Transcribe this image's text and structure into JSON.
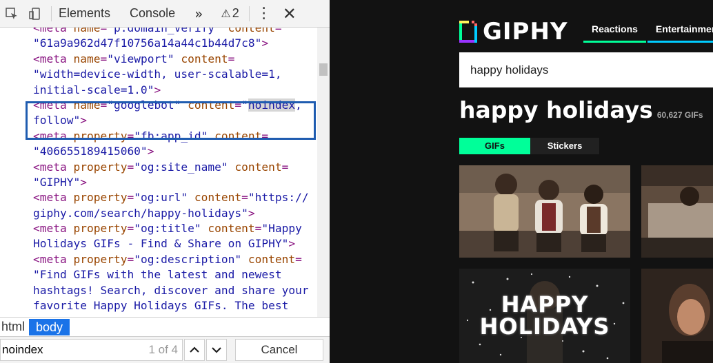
{
  "devtools": {
    "tabs": {
      "elements": "Elements",
      "console": "Console",
      "more": "»"
    },
    "warnings": {
      "icon": "warning-icon",
      "count": "2"
    },
    "code_lines": [
      [
        [
          "tag",
          "<meta "
        ],
        [
          "attr",
          "name"
        ],
        [
          "punct",
          "="
        ],
        [
          "val",
          "\"p:domain_verify\""
        ],
        [
          "attr",
          " content"
        ],
        [
          "punct",
          "="
        ]
      ],
      [
        [
          "val",
          "\"61a9a962d47f10756a14a44c1b44d7c8\""
        ],
        [
          "tag",
          ">"
        ]
      ],
      [
        [
          "tag",
          "<meta "
        ],
        [
          "attr",
          "name"
        ],
        [
          "punct",
          "="
        ],
        [
          "val",
          "\"viewport\""
        ],
        [
          "attr",
          " content"
        ],
        [
          "punct",
          "="
        ]
      ],
      [
        [
          "val",
          "\"width=device-width, user-scalable=1,"
        ]
      ],
      [
        [
          "val",
          "initial-scale=1.0\""
        ],
        [
          "tag",
          ">"
        ]
      ],
      [
        [
          "tag",
          "<meta "
        ],
        [
          "attr",
          "name"
        ],
        [
          "punct",
          "="
        ],
        [
          "val",
          "\"googlebot\""
        ],
        [
          "attr",
          " content"
        ],
        [
          "punct",
          "="
        ],
        [
          "val",
          "\""
        ],
        [
          "hl",
          "noindex"
        ],
        [
          "val",
          ","
        ]
      ],
      [
        [
          "val",
          "follow\""
        ],
        [
          "tag",
          ">"
        ]
      ],
      [
        [
          "tag",
          "<meta "
        ],
        [
          "attr",
          "property"
        ],
        [
          "punct",
          "="
        ],
        [
          "val",
          "\"fb:app_id\""
        ],
        [
          "attr",
          " content"
        ],
        [
          "punct",
          "="
        ]
      ],
      [
        [
          "val",
          "\"406655189415060\""
        ],
        [
          "tag",
          ">"
        ]
      ],
      [
        [
          "tag",
          "<meta "
        ],
        [
          "attr",
          "property"
        ],
        [
          "punct",
          "="
        ],
        [
          "val",
          "\"og:site_name\""
        ],
        [
          "attr",
          " content"
        ],
        [
          "punct",
          "="
        ]
      ],
      [
        [
          "val",
          "\"GIPHY\""
        ],
        [
          "tag",
          ">"
        ]
      ],
      [
        [
          "tag",
          "<meta "
        ],
        [
          "attr",
          "property"
        ],
        [
          "punct",
          "="
        ],
        [
          "val",
          "\"og:url\""
        ],
        [
          "attr",
          " content"
        ],
        [
          "punct",
          "="
        ],
        [
          "val",
          "\"https://"
        ]
      ],
      [
        [
          "val",
          "giphy.com/search/happy-holidays\""
        ],
        [
          "tag",
          ">"
        ]
      ],
      [
        [
          "tag",
          "<meta "
        ],
        [
          "attr",
          "property"
        ],
        [
          "punct",
          "="
        ],
        [
          "val",
          "\"og:title\""
        ],
        [
          "attr",
          " content"
        ],
        [
          "punct",
          "="
        ],
        [
          "val",
          "\"Happy"
        ]
      ],
      [
        [
          "val",
          "Holidays GIFs - Find & Share on GIPHY\""
        ],
        [
          "tag",
          ">"
        ]
      ],
      [
        [
          "tag",
          "<meta "
        ],
        [
          "attr",
          "property"
        ],
        [
          "punct",
          "="
        ],
        [
          "val",
          "\"og:description\""
        ],
        [
          "attr",
          " content"
        ],
        [
          "punct",
          "="
        ]
      ],
      [
        [
          "val",
          "\"Find GIFs with the latest and newest"
        ]
      ],
      [
        [
          "val",
          "hashtags! Search, discover and share your"
        ]
      ],
      [
        [
          "val",
          "favorite Happy Holidays GIFs. The best"
        ]
      ]
    ],
    "breadcrumb": {
      "html": "html",
      "body": "body"
    },
    "find": {
      "query": "noindex",
      "count": "1 of 4",
      "cancel": "Cancel"
    }
  },
  "giphy": {
    "logo_text": "GIPHY",
    "nav": [
      {
        "label": "Reactions",
        "color": "#00ff99"
      },
      {
        "label": "Entertainment",
        "color": "#00ccff"
      }
    ],
    "search_value": "happy holidays",
    "title": "happy holidays",
    "count": "60,627 GIFs",
    "tabs": {
      "gifs": "GIFs",
      "stickers": "Stickers"
    },
    "gif_text": {
      "line1": "HAPPY",
      "line2": "HOLIDAYS"
    }
  }
}
